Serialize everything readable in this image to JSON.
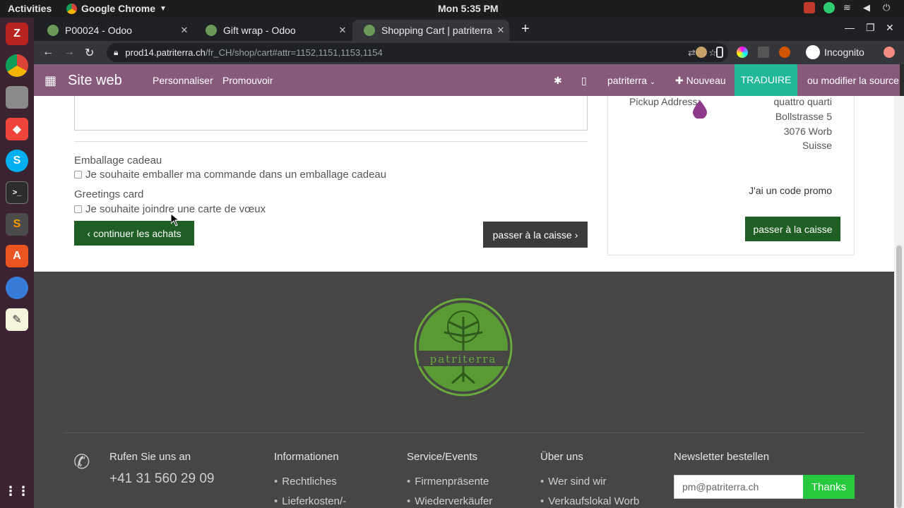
{
  "system": {
    "activities": "Activities",
    "app_name": "Google Chrome",
    "clock": "Mon  5:35 PM"
  },
  "browser": {
    "tabs": [
      {
        "title": "P00024 - Odoo"
      },
      {
        "title": "Gift wrap - Odoo"
      },
      {
        "title": "Shopping Cart | patriterra"
      }
    ],
    "url_host": "prod14.patriterra.ch",
    "url_path": "/fr_CH/shop/cart#attr=1152,1151,1153,1154",
    "incognito_label": "Incognito"
  },
  "odoo_bar": {
    "brand": "Site web",
    "menu_customize": "Personnaliser",
    "menu_promote": "Promouvoir",
    "website_switch": "patriterra",
    "new_label": "Nouveau",
    "translate_label": "TRADUIRE",
    "edit_source_label": "ou modifier la source"
  },
  "cart": {
    "gift_wrap_heading": "Emballage cadeau",
    "gift_wrap_checkbox": "Je souhaite emballer ma commande dans un emballage cadeau",
    "greetings_heading": "Greetings card",
    "greetings_checkbox": "Je souhaite joindre une carte de vœux",
    "continue_button": "continuer les achats",
    "checkout_button": "passer à la caisse"
  },
  "summary": {
    "pickup_label": "Pickup Address:",
    "address_lines": [
      "quattro quarti",
      "Bollstrasse 5",
      "3076 Worb",
      "Suisse"
    ],
    "promo_link": "J'ai un code promo",
    "checkout_button": "passer à la caisse"
  },
  "footer": {
    "logo_text": "patriterra",
    "call_heading": "Rufen Sie uns an",
    "phone_number": "+41 31 560 29 09",
    "columns": [
      {
        "heading": "Informationen",
        "links": [
          "Rechtliches",
          "Lieferkosten/-"
        ]
      },
      {
        "heading": "Service/Events",
        "links": [
          "Firmenpräsente",
          "Wiederverkäufer"
        ]
      },
      {
        "heading": "Über uns",
        "links": [
          "Wer sind wir",
          "Verkaufslokal Worb"
        ]
      }
    ],
    "newsletter_heading": "Newsletter bestellen",
    "newsletter_value": "pm@patriterra.ch",
    "newsletter_button": "Thanks"
  },
  "colors": {
    "odoo_purple": "#875a7b",
    "translate_teal": "#21b799",
    "button_green": "#1f5f24",
    "newsletter_green": "#27c93f",
    "footer_bg": "#464644"
  }
}
